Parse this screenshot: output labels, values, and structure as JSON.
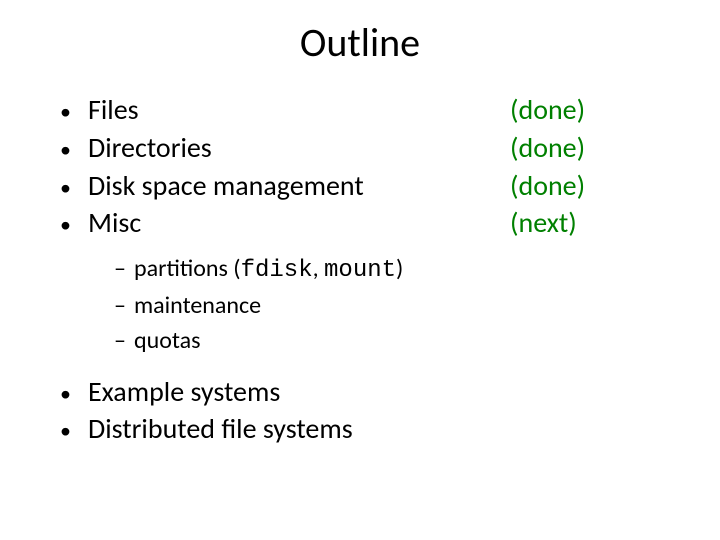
{
  "title": "Outline",
  "items": [
    {
      "label": "Files",
      "status": "(done)"
    },
    {
      "label": "Directories",
      "status": "(done)"
    },
    {
      "label": "Disk space management",
      "status": "(done)"
    },
    {
      "label": "Misc",
      "status": "(next)"
    }
  ],
  "sub": {
    "part_prefix": "partitions (",
    "part_cmd1": "fdisk",
    "part_sep": ", ",
    "part_cmd2": "mount",
    "part_suffix": ")",
    "maintenance": "maintenance",
    "quotas": "quotas"
  },
  "tail": [
    "Example systems",
    "Distributed file systems"
  ],
  "glyphs": {
    "bullet": "•",
    "dash": "–"
  }
}
